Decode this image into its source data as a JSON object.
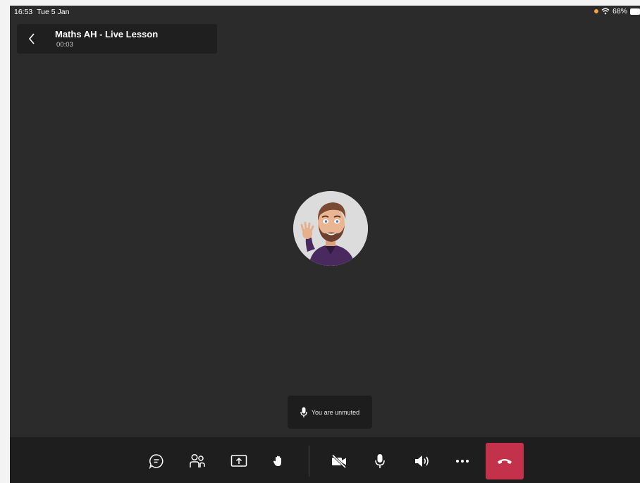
{
  "status_bar": {
    "time": "16:53",
    "date": "Tue 5 Jan",
    "battery": "68%"
  },
  "meeting": {
    "title": "Maths AH - Live Lesson",
    "timer": "00:03"
  },
  "toast": {
    "text": "You are unmuted"
  },
  "toolbar": {
    "items": [
      "chat-icon",
      "participants-icon",
      "share-screen-icon",
      "raise-hand-icon",
      "camera-off-icon",
      "microphone-icon",
      "speaker-icon",
      "more-options-icon",
      "end-call-icon"
    ]
  },
  "colors": {
    "stage_background": "#2c2b2c",
    "toolbar_background": "#1e1e1e",
    "end_call": "#c4314b",
    "mic_indicator": "#f7a13a"
  }
}
